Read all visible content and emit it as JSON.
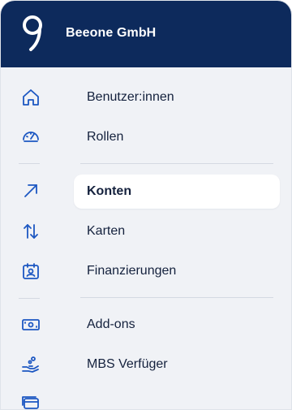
{
  "header": {
    "company_name": "Beeone GmbH",
    "logo_icon": "beeone-logo-icon",
    "background_color": "#0d2a5c"
  },
  "rail": {
    "icons": [
      "home-icon",
      "dashboard-gauge-icon",
      "arrow-up-right-icon",
      "transfer-arrows-icon",
      "calendar-user-icon",
      "banknote-icon",
      "hand-coins-icon",
      "cards-icon"
    ],
    "accent_color": "#1c57c2"
  },
  "menu": {
    "items": [
      {
        "label": "Benutzer:innen",
        "active": false
      },
      {
        "label": "Rollen",
        "active": false
      },
      {
        "label": "Konten",
        "active": true
      },
      {
        "label": "Karten",
        "active": false
      },
      {
        "label": "Finanzierungen",
        "active": false
      },
      {
        "label": "Add-ons",
        "active": false
      },
      {
        "label": "MBS Verfüger",
        "active": false
      }
    ]
  }
}
